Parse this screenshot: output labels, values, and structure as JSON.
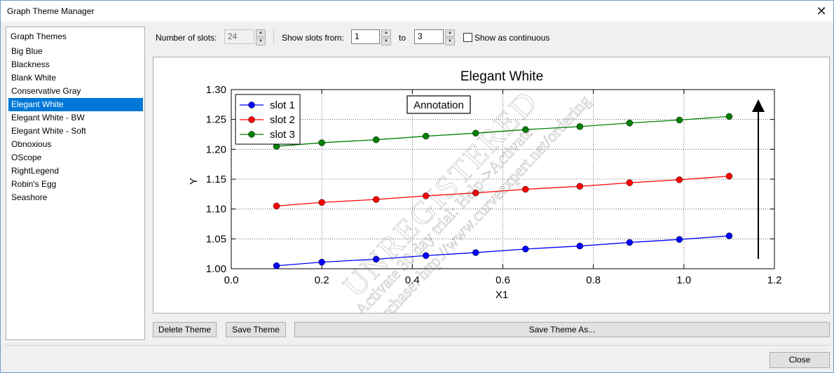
{
  "window": {
    "title": "Graph Theme Manager",
    "close_glyph": "✕"
  },
  "themes": {
    "header": "Graph Themes",
    "items": [
      "Big Blue",
      "Blackness",
      "Blank White",
      "Conservative Gray",
      "Elegant White",
      "Elegant White - BW",
      "Elegant White - Soft",
      "Obnoxious",
      "OScope",
      "RightLegend",
      "Robin's Egg",
      "Seashore"
    ],
    "selected_index": 4
  },
  "toolbar": {
    "num_slots_label": "Number of slots:",
    "num_slots_value": "24",
    "show_from_label": "Show slots from:",
    "from_value": "1",
    "to_label": "to",
    "to_value": "3",
    "continuous_label": "Show as continuous",
    "continuous_checked": false
  },
  "buttons": {
    "delete": "Delete Theme",
    "save": "Save Theme",
    "save_as": "Save Theme As...",
    "close": "Close"
  },
  "watermark": {
    "line1": "UNREGISTERED",
    "line2": "Activate 30 day trial: Help->Activate",
    "line3": "Purchase: http://www.curveexpert.net/ordering"
  },
  "chart_data": {
    "type": "line",
    "title": "Elegant White",
    "xlabel": "X1",
    "ylabel": "Y",
    "xlim": [
      0.0,
      1.2
    ],
    "ylim": [
      1.0,
      1.3
    ],
    "x_ticks": [
      "0.0",
      "0.2",
      "0.4",
      "0.6",
      "0.8",
      "1.0",
      "1.2"
    ],
    "y_ticks": [
      "1.00",
      "1.05",
      "1.10",
      "1.15",
      "1.20",
      "1.25",
      "1.30"
    ],
    "grid": true,
    "legend_position": "top-left",
    "annotation": "Annotation",
    "x": [
      0.1,
      0.2,
      0.32,
      0.43,
      0.54,
      0.65,
      0.77,
      0.88,
      0.99,
      1.1
    ],
    "series": [
      {
        "name": "slot 1",
        "color": "#0000ff",
        "values": [
          1.005,
          1.011,
          1.016,
          1.022,
          1.027,
          1.033,
          1.038,
          1.044,
          1.049,
          1.055
        ]
      },
      {
        "name": "slot 2",
        "color": "#ff0000",
        "values": [
          1.105,
          1.111,
          1.116,
          1.122,
          1.127,
          1.133,
          1.138,
          1.144,
          1.149,
          1.155
        ]
      },
      {
        "name": "slot 3",
        "color": "#008000",
        "values": [
          1.205,
          1.211,
          1.216,
          1.222,
          1.227,
          1.233,
          1.238,
          1.244,
          1.249,
          1.255
        ]
      }
    ]
  }
}
